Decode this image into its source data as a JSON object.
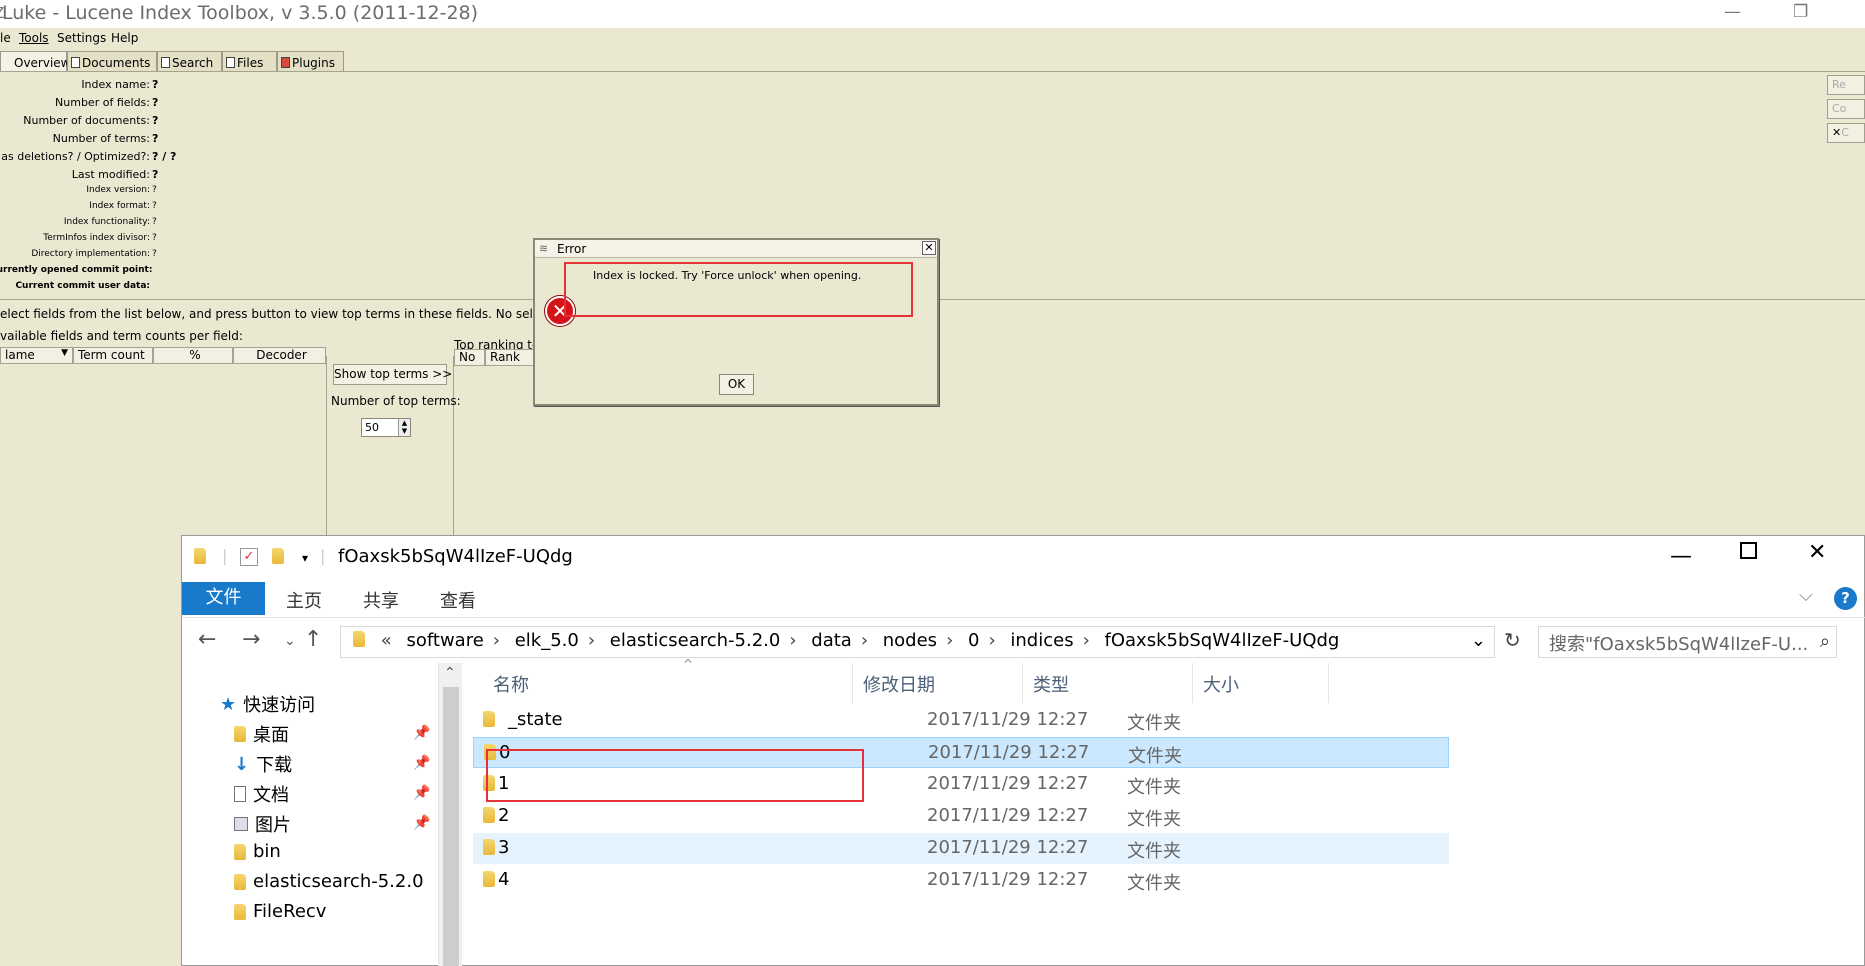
{
  "luke": {
    "title": "Luke - Lucene Index Toolbox, v 3.5.0 (2011-12-28)",
    "menu": [
      "le",
      "Tools",
      "Settings",
      "Help"
    ],
    "tabs": [
      "Overview",
      "Documents",
      "Search",
      "Files",
      "Plugins"
    ],
    "info": [
      {
        "label": "Index name:",
        "value": "?"
      },
      {
        "label": "Number of fields:",
        "value": "?"
      },
      {
        "label": "Number of documents:",
        "value": "?"
      },
      {
        "label": "Number of terms:",
        "value": "?"
      },
      {
        "label": "as deletions? / Optimized?:",
        "value": "? / ?"
      },
      {
        "label": "Last modified:",
        "value": "?"
      },
      {
        "label": "Index version:",
        "value": "?"
      },
      {
        "label": "Index format:",
        "value": "?"
      },
      {
        "label": "Index functionality:",
        "value": "?"
      },
      {
        "label": "TermInfos index divisor:",
        "value": "?"
      },
      {
        "label": "Directory implementation:",
        "value": "?"
      },
      {
        "label": "Currently opened commit point:",
        "value": ""
      },
      {
        "label": "Current commit user data:",
        "value": ""
      }
    ],
    "side_buttons": [
      "Re",
      "Co",
      "C"
    ],
    "select_hint": "elect fields from the list below, and press button to view top terms in these fields. No selection me",
    "fields_label": "vailable fields and term counts per field:",
    "columns": [
      "lame",
      "Term count",
      "%",
      "Decoder"
    ],
    "show_top_terms": "Show top terms >>",
    "num_top_terms_label": "Number of top terms:",
    "num_top_terms_value": "50",
    "top_ranking_label": "Top ranking te",
    "top_columns": [
      "No",
      "Rank"
    ]
  },
  "error_dialog": {
    "title": "Error",
    "message": "Index is locked. Try 'Force unlock' when opening.",
    "ok": "OK"
  },
  "explorer": {
    "title": "fOaxsk5bSqW4lIzeF-UQdg",
    "ribbon_tabs": [
      "文件",
      "主页",
      "共享",
      "查看"
    ],
    "breadcrumb_prefix": "«",
    "breadcrumb": [
      "software",
      "elk_5.0",
      "elasticsearch-5.2.0",
      "data",
      "nodes",
      "0",
      "indices",
      "fOaxsk5bSqW4lIzeF-UQdg"
    ],
    "search_placeholder": "搜索\"fOaxsk5bSqW4lIzeF-U...",
    "nav": [
      {
        "label": "快速访问",
        "pinned": false
      },
      {
        "label": "桌面",
        "pinned": true
      },
      {
        "label": "下载",
        "pinned": true
      },
      {
        "label": "文档",
        "pinned": true
      },
      {
        "label": "图片",
        "pinned": true
      },
      {
        "label": "bin",
        "pinned": false
      },
      {
        "label": "elasticsearch-5.2.0",
        "pinned": false
      },
      {
        "label": "FileRecv",
        "pinned": false
      }
    ],
    "columns": [
      "名称",
      "修改日期",
      "类型",
      "大小"
    ],
    "rows": [
      {
        "name": "_state",
        "date": "2017/11/29 12:27",
        "type": "文件夹"
      },
      {
        "name": "0",
        "date": "2017/11/29 12:27",
        "type": "文件夹"
      },
      {
        "name": "1",
        "date": "2017/11/29 12:27",
        "type": "文件夹"
      },
      {
        "name": "2",
        "date": "2017/11/29 12:27",
        "type": "文件夹"
      },
      {
        "name": "3",
        "date": "2017/11/29 12:27",
        "type": "文件夹"
      },
      {
        "name": "4",
        "date": "2017/11/29 12:27",
        "type": "文件夹"
      }
    ],
    "colors": {
      "accent": "#1979ca",
      "selected_row": "#cce8ff",
      "hover_row": "#e5f3ff",
      "annotation": "#e53238"
    }
  }
}
